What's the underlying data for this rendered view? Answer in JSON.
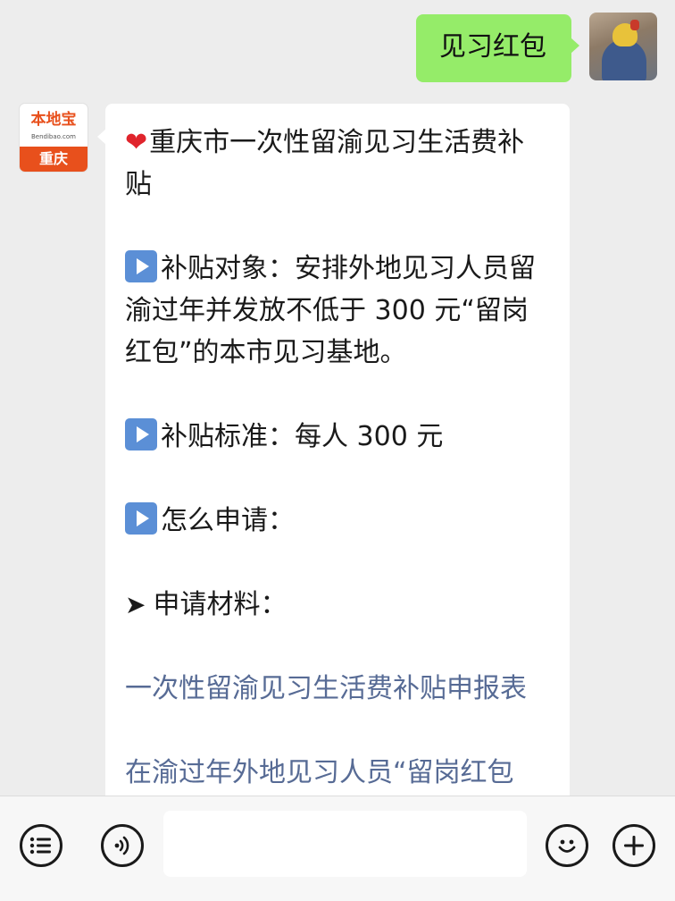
{
  "outgoing_message": {
    "text": "见习红包"
  },
  "contact": {
    "logo_text": "本地宝",
    "domain_text": "Bendibao.com",
    "city_text": "重庆"
  },
  "incoming_message": {
    "title": "重庆市一次性留渝见习生活费补贴",
    "target_label": "补贴对象：",
    "target_text": "安排外地见习人员留渝过年并发放不低于 300 元“留岗红包”的本市见习基地。",
    "standard_label": "补贴标准：",
    "standard_text": "每人 300 元",
    "how_label": "怎么申请：",
    "materials_label": "申请材料：",
    "link1": "一次性留渝见习生活费补贴申报表",
    "link2": "在渝过年外地见习人员“留岗红包"
  },
  "icons": {
    "heart": "heart-icon",
    "play": "play-icon",
    "arrow": "arrowhead-icon",
    "menu": "menu-icon",
    "voice": "voice-icon",
    "emoji": "emoji-icon",
    "plus": "plus-icon"
  },
  "colors": {
    "chat_bg": "#ededed",
    "outgoing_bubble": "#95ec69",
    "incoming_bubble": "#ffffff",
    "link": "#576b95",
    "play_icon": "#5b8fd6",
    "brand_orange": "#e8501c"
  }
}
